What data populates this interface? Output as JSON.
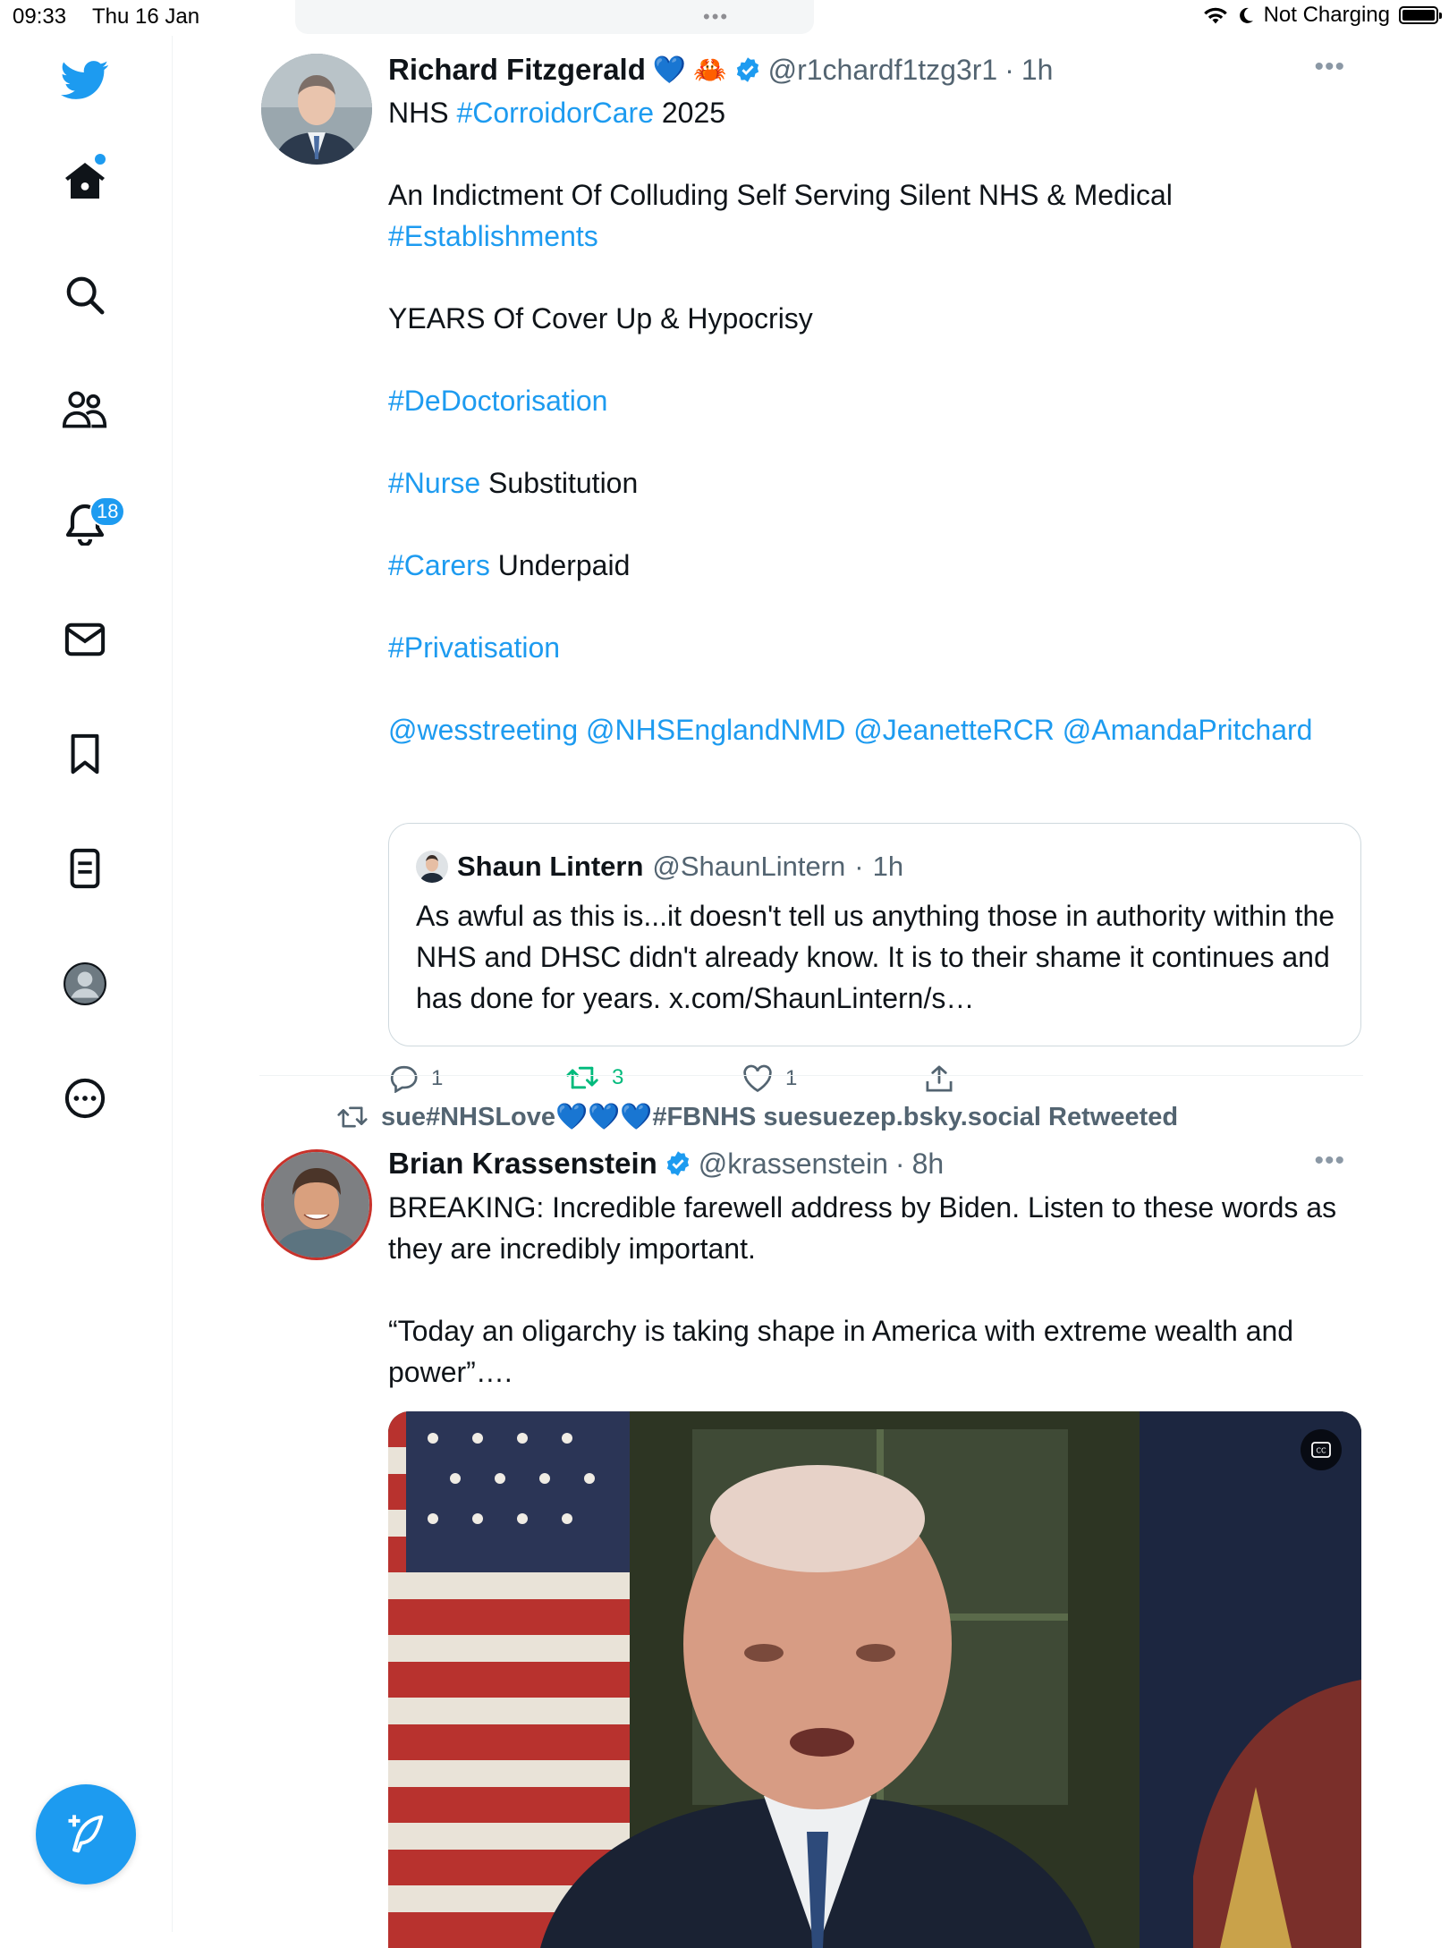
{
  "status_bar": {
    "time": "09:33",
    "date": "Thu 16 Jan",
    "charging": "Not Charging"
  },
  "sidebar": {
    "notifications_badge": "18",
    "items": [
      {
        "icon": "twitter-logo-icon"
      },
      {
        "icon": "home-icon"
      },
      {
        "icon": "search-icon"
      },
      {
        "icon": "communities-icon"
      },
      {
        "icon": "notifications-bell-icon"
      },
      {
        "icon": "messages-envelope-icon"
      },
      {
        "icon": "bookmark-icon"
      },
      {
        "icon": "lists-icon"
      },
      {
        "icon": "profile-avatar-icon"
      },
      {
        "icon": "more-circle-icon"
      }
    ],
    "compose_icon": "compose-feather-icon"
  },
  "tweet1": {
    "name": "Richard Fitzgerald",
    "emoji_heart": "💙",
    "emoji_crab": "🦀",
    "handle": "@r1chardf1tzg3r1",
    "sep": "·",
    "time": "1h",
    "line1_pre": "NHS ",
    "line1_tag": "#CorroidorCare",
    "line1_post": " 2025",
    "line2": "An Indictment Of Colluding Self Serving Silent NHS & Medical",
    "line2_tag": "#Establishments",
    "line3": "YEARS Of Cover Up & Hypocrisy",
    "line4_tag": "#DeDoctorisation",
    "line5_tag": "#Nurse",
    "line5_post": " Substitution",
    "line6_tag": "#Carers",
    "line6_post": " Underpaid",
    "line7_tag": "#Privatisation",
    "mentions": "@wesstreeting @NHSEnglandNMD @JeanetteRCR @AmandaPritchard",
    "quote": {
      "name": "Shaun Lintern",
      "handle": "@ShaunLintern",
      "sep": "·",
      "time": "1h",
      "text": "As awful as this is...it doesn't tell us anything those in authority within the NHS and DHSC didn't already know. It is to their shame it continues and has done for years. x.com/ShaunLintern/s…"
    },
    "replies": "1",
    "retweets": "3",
    "likes": "1"
  },
  "retweet_banner": {
    "text_pre": "sue#NHSLove",
    "hearts": "💙💙💙",
    "text_post": "#FBNHS suesuezep.bsky.social Retweeted"
  },
  "tweet2": {
    "name": "Brian Krassenstein",
    "handle": "@krassenstein",
    "sep": "·",
    "time": "8h",
    "line1": "BREAKING: Incredible farewell address by Biden. Listen to these words as they are incredibly important.",
    "line2": "“Today an oligarchy is taking shape in America with extreme wealth and power”….",
    "media_icon": "closed-captions-icon"
  },
  "colors": {
    "accent": "#1d9bf0",
    "retweet_green": "#00ba7c",
    "muted": "#536471"
  }
}
